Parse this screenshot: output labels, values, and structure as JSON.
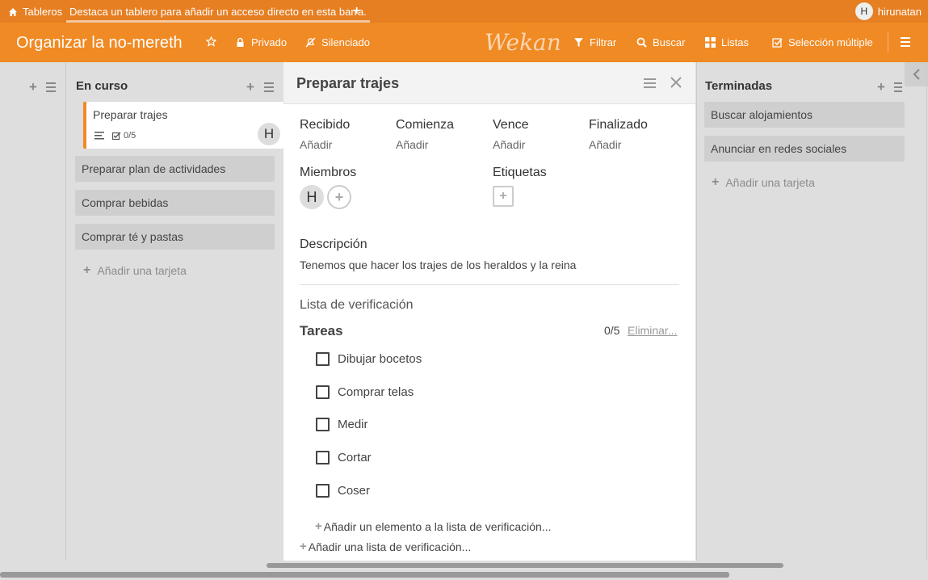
{
  "topbar": {
    "home_label": "Tableros",
    "tip": "Destaca un tablero para añadir un acceso directo en esta barra.",
    "add_symbol": "+",
    "user_initial": "H",
    "username": "hirunatan"
  },
  "header": {
    "board_title": "Organizar la no-mereth",
    "private_label": "Privado",
    "muted_label": "Silenciado",
    "logo_text": "Wekan",
    "filter_label": "Filtrar",
    "search_label": "Buscar",
    "lists_label": "Listas",
    "multiselect_label": "Selección múltiple"
  },
  "lists": [
    {
      "title": "En curso",
      "cards": [
        {
          "title": "Preparar trajes",
          "checklist_badge": "0/5",
          "member_initial": "H"
        },
        {
          "title": "Preparar plan de actividades"
        },
        {
          "title": "Comprar bebidas"
        },
        {
          "title": "Comprar té y pastas"
        }
      ],
      "add_card_label": "Añadir una tarjeta"
    },
    {
      "title": "Terminadas",
      "cards": [
        {
          "title": "Buscar alojamientos"
        },
        {
          "title": "Anunciar en redes sociales"
        }
      ],
      "add_card_label": "Añadir una tarjeta"
    }
  ],
  "details": {
    "title": "Preparar trajes",
    "dates": [
      {
        "label": "Recibido",
        "value": "Añadir"
      },
      {
        "label": "Comienza",
        "value": "Añadir"
      },
      {
        "label": "Vence",
        "value": "Añadir"
      },
      {
        "label": "Finalizado",
        "value": "Añadir"
      }
    ],
    "members_label": "Miembros",
    "member_initial": "H",
    "labels_label": "Etiquetas",
    "description_label": "Descripción",
    "description": "Tenemos que hacer los trajes de los heraldos y la reina",
    "checklist_section": "Lista de verificación",
    "checklist": {
      "name": "Tareas",
      "count": "0/5",
      "delete_label": "Eliminar...",
      "items": [
        "Dibujar bocetos",
        "Comprar telas",
        "Medir",
        "Cortar",
        "Coser"
      ],
      "add_item_label": "Añadir un elemento a la lista de verificación..."
    },
    "add_checklist_label": "Añadir una lista de verificación..."
  },
  "colors": {
    "accent": "#f08a24",
    "topbar": "#e67e22"
  }
}
